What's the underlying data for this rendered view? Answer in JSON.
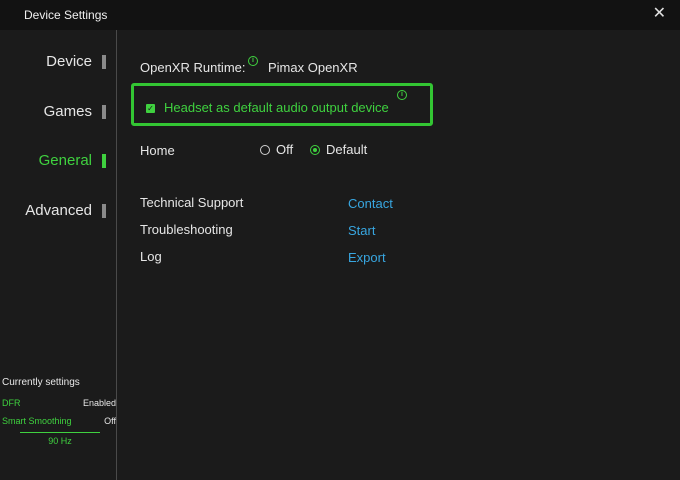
{
  "window": {
    "title": "Device Settings",
    "close_glyph": "✕"
  },
  "sidebar": {
    "items": [
      {
        "label": "Device",
        "active": false
      },
      {
        "label": "Games",
        "active": false
      },
      {
        "label": "General",
        "active": true
      },
      {
        "label": "Advanced",
        "active": false
      }
    ],
    "current_settings": {
      "title": "Currently settings",
      "rows": [
        {
          "key": "DFR",
          "value": "Enabled"
        },
        {
          "key": "Smart Smoothing",
          "value": "Off"
        }
      ],
      "refresh": "90 Hz"
    }
  },
  "main": {
    "runtime": {
      "label": "OpenXR Runtime:",
      "value": "Pimax OpenXR"
    },
    "headset_audio": {
      "label": "Headset as default audio output device",
      "checked": true
    },
    "home": {
      "label": "Home",
      "options": [
        "Off",
        "Default"
      ],
      "selected": "Default"
    },
    "support": [
      {
        "label": "Technical Support",
        "action": "Contact"
      },
      {
        "label": "Troubleshooting",
        "action": "Start"
      },
      {
        "label": "Log",
        "action": "Export"
      }
    ]
  },
  "colors": {
    "accent": "#3fd13f",
    "link": "#38a6e0",
    "background": "#1b1b1b",
    "titlebar": "#121212"
  },
  "icons": {
    "info": "info-icon",
    "checkmark": "checkmark-icon",
    "close": "close-icon"
  }
}
